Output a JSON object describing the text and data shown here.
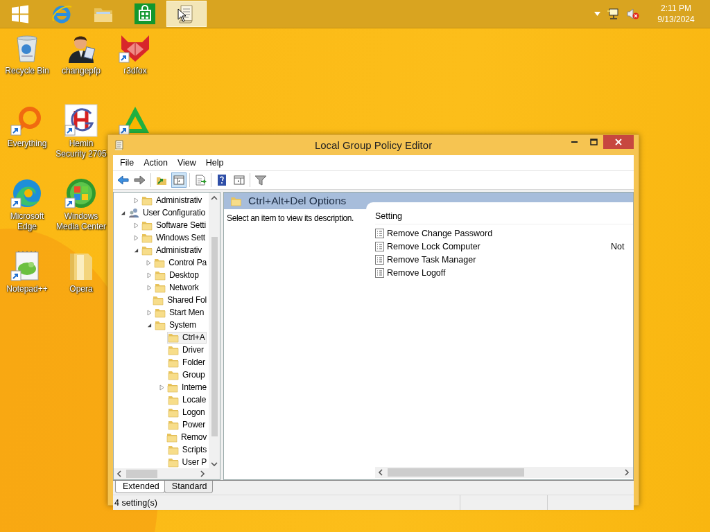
{
  "taskbar": {
    "items": [
      {
        "kind": "start",
        "active": false
      },
      {
        "kind": "ie",
        "active": false
      },
      {
        "kind": "explorer",
        "active": false
      },
      {
        "kind": "store",
        "active": false
      },
      {
        "kind": "gpedit",
        "active": true
      }
    ],
    "tray": {
      "volume_muted": true,
      "time": "2:11 PM",
      "date": "9/13/2024"
    }
  },
  "desktop_icons": [
    {
      "label": "Recycle Bin",
      "kind": "recycle",
      "shortcut": false
    },
    {
      "label": "Everything",
      "kind": "everything",
      "shortcut": true
    },
    {
      "label": "Microsoft Edge",
      "kind": "edge",
      "shortcut": true
    },
    {
      "label": "Notepad++",
      "kind": "notepad",
      "shortcut": true
    },
    {
      "label": "changepfp",
      "kind": "person",
      "shortcut": false
    },
    {
      "label": "Hemin Security 2705",
      "kind": "hemin",
      "shortcut": true
    },
    {
      "label": "Windows Media Center",
      "kind": "wmc",
      "shortcut": true
    },
    {
      "label": "Opera",
      "kind": "folder",
      "shortcut": false
    },
    {
      "label": "r3dfox",
      "kind": "fox",
      "shortcut": true
    },
    {
      "kind": "triangle",
      "shortcut": true
    }
  ],
  "window": {
    "title": "Local Group Policy Editor",
    "menu": [
      "File",
      "Action",
      "View",
      "Help"
    ],
    "toolbar": [
      {
        "kind": "back",
        "pressed": false
      },
      {
        "kind": "forward",
        "pressed": false
      },
      {
        "kind": "up",
        "pressed": false
      },
      {
        "kind": "tree",
        "pressed": true
      },
      {
        "kind": "export",
        "pressed": false
      },
      {
        "kind": "help",
        "pressed": false
      },
      {
        "kind": "panel",
        "pressed": false
      },
      {
        "kind": "filter",
        "pressed": false
      }
    ],
    "tree": [
      {
        "children": [
          {
            "label": "Administrativ",
            "expanded": false,
            "selected": false
          }
        ]
      },
      {
        "label": "User Configuratio",
        "expanded": true,
        "selected": false,
        "kind": "user",
        "children": [
          {
            "label": "Software Setti",
            "expanded": false,
            "selected": false
          },
          {
            "label": "Windows Sett",
            "expanded": false,
            "selected": false
          },
          {
            "label": "Administrativ",
            "expanded": true,
            "selected": false,
            "children": [
              {
                "label": "Control Pa",
                "expanded": false,
                "selected": false
              },
              {
                "label": "Desktop",
                "expanded": false,
                "selected": false
              },
              {
                "label": "Network",
                "expanded": false,
                "selected": false
              },
              {
                "label": "Shared Fol",
                "selected": false
              },
              {
                "label": "Start Men",
                "expanded": false,
                "selected": false
              },
              {
                "label": "System",
                "expanded": true,
                "selected": false,
                "children": [
                  {
                    "label": "Ctrl+A",
                    "selected": true
                  },
                  {
                    "label": "Driver",
                    "selected": false
                  },
                  {
                    "label": "Folder",
                    "selected": false
                  },
                  {
                    "label": "Group",
                    "selected": false
                  },
                  {
                    "label": "Interne",
                    "expanded": false,
                    "selected": false
                  },
                  {
                    "label": "Locale",
                    "selected": false
                  },
                  {
                    "label": "Logon",
                    "selected": false
                  },
                  {
                    "label": "Power",
                    "selected": false
                  },
                  {
                    "label": "Remov",
                    "selected": false
                  },
                  {
                    "label": "Scripts",
                    "selected": false
                  },
                  {
                    "label": "User P",
                    "selected": false
                  }
                ]
              }
            ]
          }
        ]
      }
    ],
    "pane": {
      "title": "Ctrl+Alt+Del Options",
      "description": "Select an item to view its description.",
      "columns": [
        "Setting"
      ],
      "rows": [
        {
          "setting": "Remove Change Password"
        },
        {
          "setting": "Remove Lock Computer",
          "column_2": "Not"
        },
        {
          "setting": "Remove Task Manager"
        },
        {
          "setting": "Remove Logoff"
        }
      ]
    },
    "tabs": [
      {
        "label": "Extended",
        "selected": true
      },
      {
        "label": "Standard",
        "selected": false
      }
    ],
    "status_bar": "4 setting(s)"
  }
}
